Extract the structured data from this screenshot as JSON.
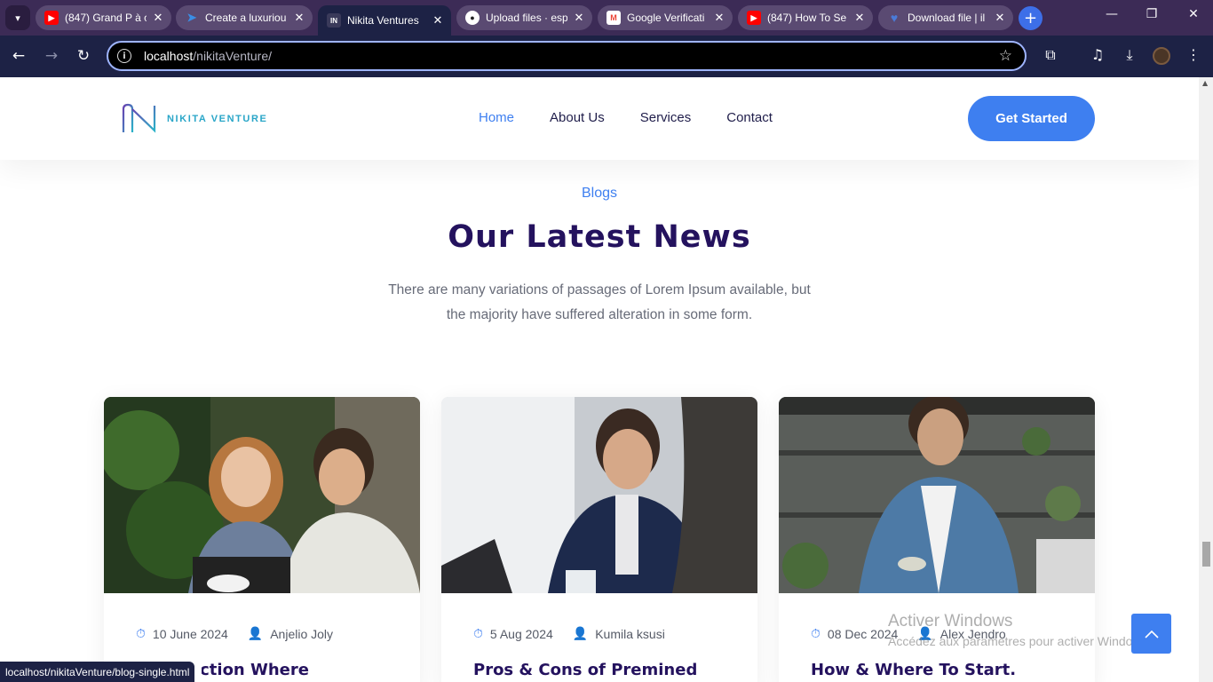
{
  "browser": {
    "tabs": [
      {
        "title": "(847) Grand P à c",
        "favicon": "youtube-icon",
        "color": "#ff0000"
      },
      {
        "title": "Create a luxuriou",
        "favicon": "bird-icon",
        "color": "#3a8ee6"
      },
      {
        "title": "Nikita Ventures",
        "favicon": "site-icon",
        "color": "#3a3a5a",
        "active": true
      },
      {
        "title": "Upload files · esp",
        "favicon": "github-icon",
        "color": "#222222"
      },
      {
        "title": "Google Verificati",
        "favicon": "gmail-icon",
        "color": "#ea4335"
      },
      {
        "title": "(847) How To Se",
        "favicon": "youtube-icon",
        "color": "#ff0000"
      },
      {
        "title": "Download file | il",
        "favicon": "heart-icon",
        "color": "#4a7bd8"
      }
    ],
    "url_host": "localhost",
    "url_path": "/nikitaVenture/",
    "status_url": "localhost/nikitaVenture/blog-single.html"
  },
  "site": {
    "logo_text": "NIKITA VENTURE",
    "nav": [
      {
        "label": "Home",
        "active": true
      },
      {
        "label": "About Us"
      },
      {
        "label": "Services"
      },
      {
        "label": "Contact"
      }
    ],
    "cta_label": "Get Started",
    "accent": "#3e7ff0",
    "heading_color": "#24125e"
  },
  "blog": {
    "eyebrow": "Blogs",
    "title": "Our Latest News",
    "lead_line1": "There are many variations of passages of Lorem Ipsum available, but",
    "lead_line2": "the majority have suffered alteration in some form.",
    "posts": [
      {
        "date": "10 June 2024",
        "author": "Anjelio Joly",
        "title": "Intersection Where"
      },
      {
        "date": "5 Aug 2024",
        "author": "Kumila ksusi",
        "title": "Pros & Cons of Premined"
      },
      {
        "date": "08 Dec 2024",
        "author": "Alex Jendro",
        "title": "How & Where To Start."
      }
    ]
  },
  "overlay": {
    "watermark_title": "Activer Windows",
    "watermark_sub": "Accédez aux paramètres pour activer Windows."
  }
}
